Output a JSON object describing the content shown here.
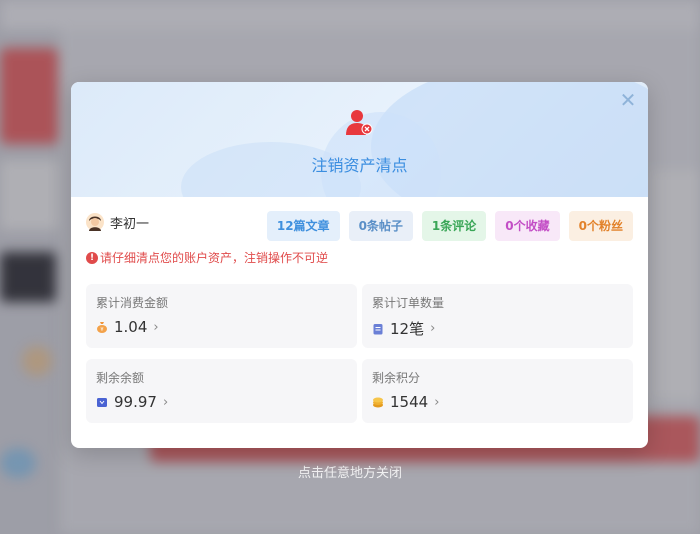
{
  "modal": {
    "title": "注销资产清点",
    "close_symbol": "✕",
    "user": {
      "name": "李初一"
    },
    "tags": [
      {
        "label": "12篇文章"
      },
      {
        "label": "0条帖子"
      },
      {
        "label": "1条评论"
      },
      {
        "label": "0个收藏"
      },
      {
        "label": "0个粉丝"
      }
    ],
    "warning": {
      "icon": "!",
      "text": "请仔细清点您的账户资产，注销操作不可逆"
    },
    "cards": [
      {
        "label": "累计消费金额",
        "value": "1.04",
        "icon": "money-bag-icon"
      },
      {
        "label": "累计订单数量",
        "value": "12笔",
        "icon": "order-icon"
      },
      {
        "label": "剩余余额",
        "value": "99.97",
        "icon": "wallet-icon"
      },
      {
        "label": "剩余积分",
        "value": "1544",
        "icon": "points-icon"
      }
    ],
    "chevron": "›"
  },
  "overlay_hint": "点击任意地方关闭",
  "colors": {
    "accent": "#3b8ee0",
    "warning": "#e04b4b",
    "header_bg": "#dceaf9"
  }
}
